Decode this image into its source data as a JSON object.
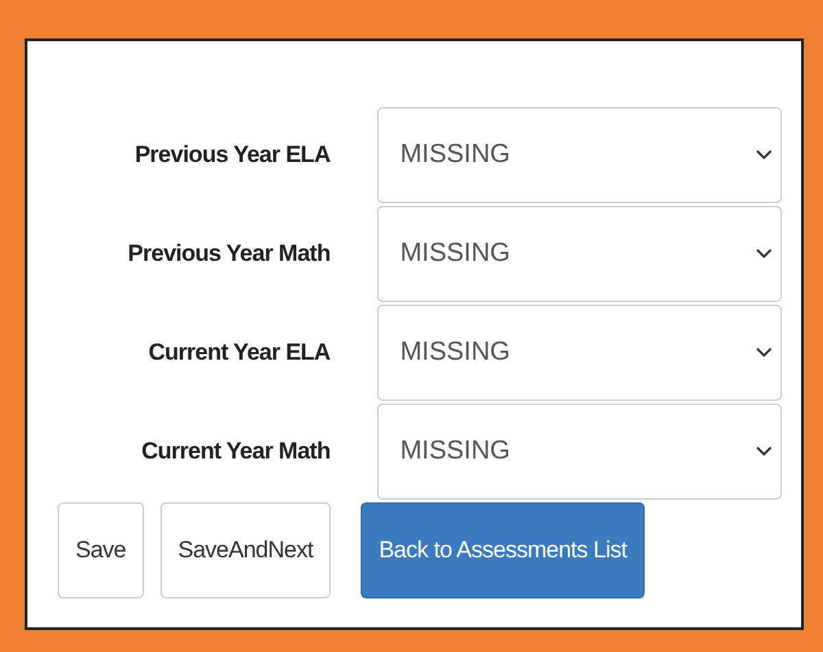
{
  "fields": [
    {
      "label": "Previous Year ELA",
      "value": "MISSING"
    },
    {
      "label": "Previous Year Math",
      "value": "MISSING"
    },
    {
      "label": "Current Year ELA",
      "value": "MISSING"
    },
    {
      "label": "Current Year Math",
      "value": "MISSING"
    }
  ],
  "buttons": [
    {
      "label": "Save",
      "kind": "default"
    },
    {
      "label": "SaveAndNext",
      "kind": "default"
    },
    {
      "label": "Back to Assessments List",
      "kind": "primary"
    }
  ]
}
